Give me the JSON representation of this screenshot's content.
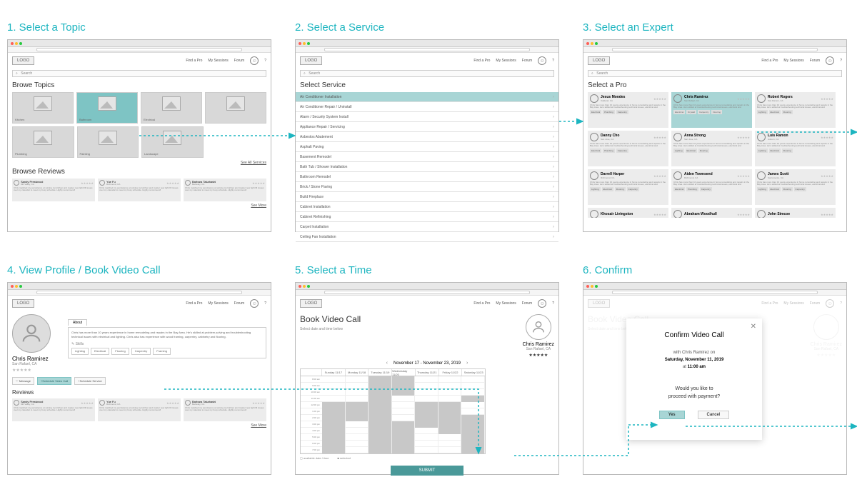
{
  "steps": {
    "s1": "1. Select a Topic",
    "s2": "2. Select a Service",
    "s3": "3. Select an Expert",
    "s4": "4. View Profile / Book Video Call",
    "s5": "5. Select a Time",
    "s6": "6. Confirm"
  },
  "common": {
    "logo": "LOGO",
    "nav1": "Find a Pro",
    "nav2": "My Sessions",
    "nav3": "Forum",
    "help": "?",
    "search": "Search"
  },
  "topics": {
    "title": "Browe Topics",
    "items": [
      "Kitchen",
      "Bathroom",
      "Electrical",
      "",
      "Plumbing",
      "Painting",
      "Landscape"
    ],
    "see_all": "See All Services",
    "reviews_title": "Browse Reviews",
    "see_more": "See More"
  },
  "reviews": [
    {
      "name": "Sandy Prestwood",
      "loc": "Mill Valley, CA"
    },
    {
      "name": "Yue Fu",
      "loc": "Richmond, CA"
    },
    {
      "name": "Barbara Takahashi",
      "loc": "Berkeley, CA"
    }
  ],
  "review_text": "Chris matched my persistence at solving my kitchen and master new light fill issues over my calendar to meet my busy schedule. Highly recommend!",
  "services": {
    "title": "Select Service",
    "list": [
      "Air Conditioner Installation",
      "Air Conditioner Repair / Uninstall",
      "Alarm / Security System Install",
      "Appliance Repair / Servicing",
      "Asbestos Abatement",
      "Asphalt Paving",
      "Basement Remodel",
      "Bath Tub / Shower Installation",
      "Bathroom Remodel",
      "Brick / Stone Paving",
      "Build Fireplace",
      "Cabinet Installation",
      "Cabinet Refinishing",
      "Carpet Installation",
      "Ceiling Fan Installation"
    ]
  },
  "experts": {
    "title": "Select a Pro",
    "list": [
      {
        "name": "Jesus Morales",
        "loc": "Oakland, CA",
        "tags": [
          "Electrical",
          "Plumbing",
          "Carpentry"
        ]
      },
      {
        "name": "Chris Ramirez",
        "loc": "San Rafael, CA",
        "tags": [
          "Electrical",
          "Drywall",
          "Carpentry",
          "Flooring"
        ]
      },
      {
        "name": "Robert Rogers",
        "loc": "San Ramon, CA",
        "tags": [
          "Lighting",
          "Electrical",
          "Flooring"
        ]
      },
      {
        "name": "Danny Cho",
        "loc": "San Jose, CA",
        "tags": [
          "Electrical",
          "Plumbing",
          "Carpentry"
        ]
      },
      {
        "name": "Anna Strong",
        "loc": "San Jose, CA",
        "tags": [
          "Lighting",
          "Electrical",
          "Flooring"
        ]
      },
      {
        "name": "Luis Ramon",
        "loc": "Auburn, CA",
        "tags": [
          "Lighting",
          "Electrical",
          "Flooring"
        ]
      },
      {
        "name": "Darrell Harper",
        "loc": "Richmond, CA",
        "tags": [
          "Lighting",
          "Electrical",
          "Flooring",
          "Carpentry"
        ]
      },
      {
        "name": "Aiden Townsend",
        "loc": "Richmond, CA",
        "tags": [
          "Electrical",
          "Plumbing",
          "Carpentry"
        ]
      },
      {
        "name": "James Scott",
        "loc": "Sacramento, CA",
        "tags": [
          "Lighting",
          "Electrical",
          "Flooring",
          "Carpentry"
        ]
      },
      {
        "name": "Khosair Livingston",
        "loc": "",
        "tags": []
      },
      {
        "name": "Abraham Woodhull",
        "loc": "",
        "tags": []
      },
      {
        "name": "John Simcoe",
        "loc": "",
        "tags": []
      }
    ],
    "blurb": "Chris has more than 10 years experience in home remodeling and repairs in the Bay Area. He's skilled at troubleshooting technical issues, electrical and"
  },
  "profile": {
    "name": "Chris Ramirez",
    "loc": "San Rafael, CA",
    "about_tab": "About",
    "about": "Chris has more than 10 years experience in home remodeling and repairs in the Bay Area. He's skilled at problem-solving and troubleshooting technical issues with electrical and lighting. Chris also has experience with wood framing, carpentry, cabinetry and flooring.",
    "skills_label": "Skills",
    "skills": [
      "Lighting",
      "Electrical",
      "Flooring",
      "Carpentry",
      "Framing"
    ],
    "msg": "Message",
    "book_video": "+Schedule Video Call",
    "book_service": "+Schedule Service",
    "reviews_title": "Reviews",
    "see_more": "See More"
  },
  "calendar": {
    "title": "Book Video Call",
    "sub": "Select date and time below",
    "range": "November 17   -   November 23,  2019",
    "days": [
      "Sunday 11/17",
      "Monday 11/18",
      "Tuesday 11/19",
      "Wednesday 11/20",
      "Thursday 11/21",
      "Friday 11/22",
      "Saturday 11/23"
    ],
    "times": [
      "8:00 am",
      "9:00 am",
      "10:00 am",
      "11:00 am",
      "12:00 pm",
      "1:00 pm",
      "2:00 pm",
      "3:00 pm",
      "4:00 pm",
      "5:00 pm",
      "6:00 pm",
      "7:00 pm"
    ],
    "legend_avail": "available date / time",
    "legend_sel": "selected",
    "submit": "SUBMIT",
    "expert_name": "Chris Ramirez",
    "expert_loc": "San Rafael, CA"
  },
  "confirm": {
    "title": "Confirm Video Call",
    "with": "with Chris Ramirez on",
    "date": "Saturday, November 11, 2019",
    "at": "at",
    "time": "11:00 am",
    "ask1": "Would you like to",
    "ask2": "proceed with payment?",
    "yes": "Yes",
    "cancel": "Cancel"
  }
}
